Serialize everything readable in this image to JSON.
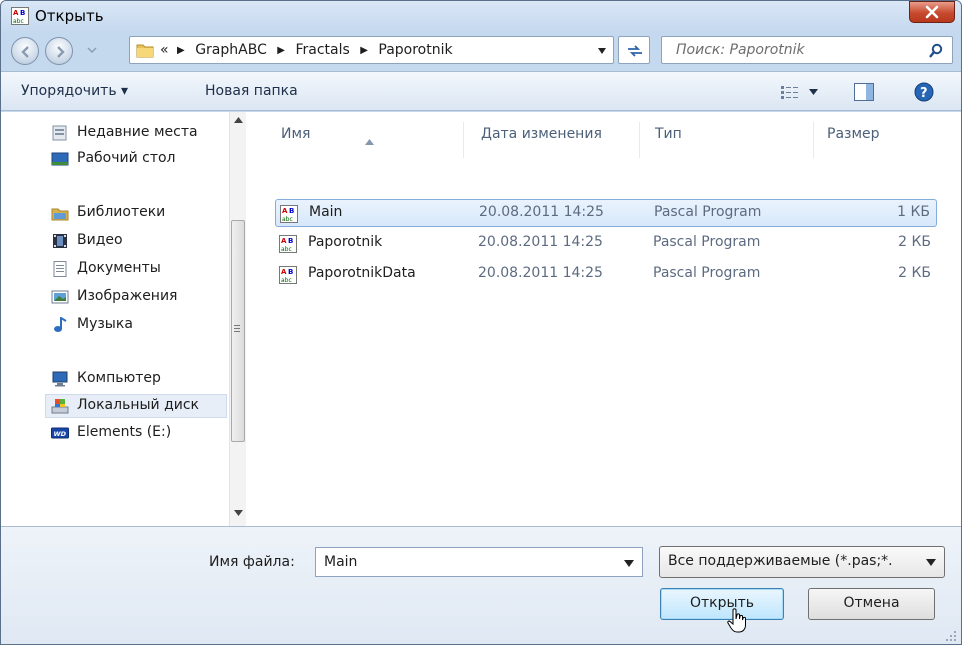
{
  "window": {
    "title": "Открыть"
  },
  "address": {
    "overflow": "«",
    "crumbs": [
      "GraphABC",
      "Fractals",
      "Paporotnik"
    ]
  },
  "search": {
    "placeholder": "Поиск: Paporotnik"
  },
  "toolbar": {
    "organize_label": "Упорядочить ▾",
    "new_folder_label": "Новая папка"
  },
  "sidebar": {
    "items": [
      {
        "label": "Недавние места",
        "icon": "recent-places-icon"
      },
      {
        "label": "Рабочий стол",
        "icon": "desktop-icon"
      },
      {
        "label": "Библиотеки",
        "icon": "libraries-icon"
      },
      {
        "label": "Видео",
        "icon": "video-icon"
      },
      {
        "label": "Документы",
        "icon": "documents-icon"
      },
      {
        "label": "Изображения",
        "icon": "pictures-icon"
      },
      {
        "label": "Музыка",
        "icon": "music-icon"
      },
      {
        "label": "Компьютер",
        "icon": "computer-icon"
      },
      {
        "label": "Локальный диск",
        "icon": "local-disk-icon"
      },
      {
        "label": "Elements (E:)",
        "icon": "external-drive-icon"
      }
    ]
  },
  "files": {
    "columns": [
      "Имя",
      "Дата изменения",
      "Тип",
      "Размер"
    ],
    "rows": [
      {
        "name": "Main",
        "date": "20.08.2011 14:25",
        "type": "Pascal Program",
        "size": "1 КБ"
      },
      {
        "name": "Paporotnik",
        "date": "20.08.2011 14:25",
        "type": "Pascal Program",
        "size": "2 КБ"
      },
      {
        "name": "PaporotnikData",
        "date": "20.08.2011 14:25",
        "type": "Pascal Program",
        "size": "2 КБ"
      }
    ]
  },
  "bottom": {
    "filename_label": "Имя файла:",
    "filename_value": "Main",
    "filetype_value": "Все поддерживаемые (*.pas;*.",
    "open_label": "Открыть",
    "cancel_label": "Отмена"
  }
}
